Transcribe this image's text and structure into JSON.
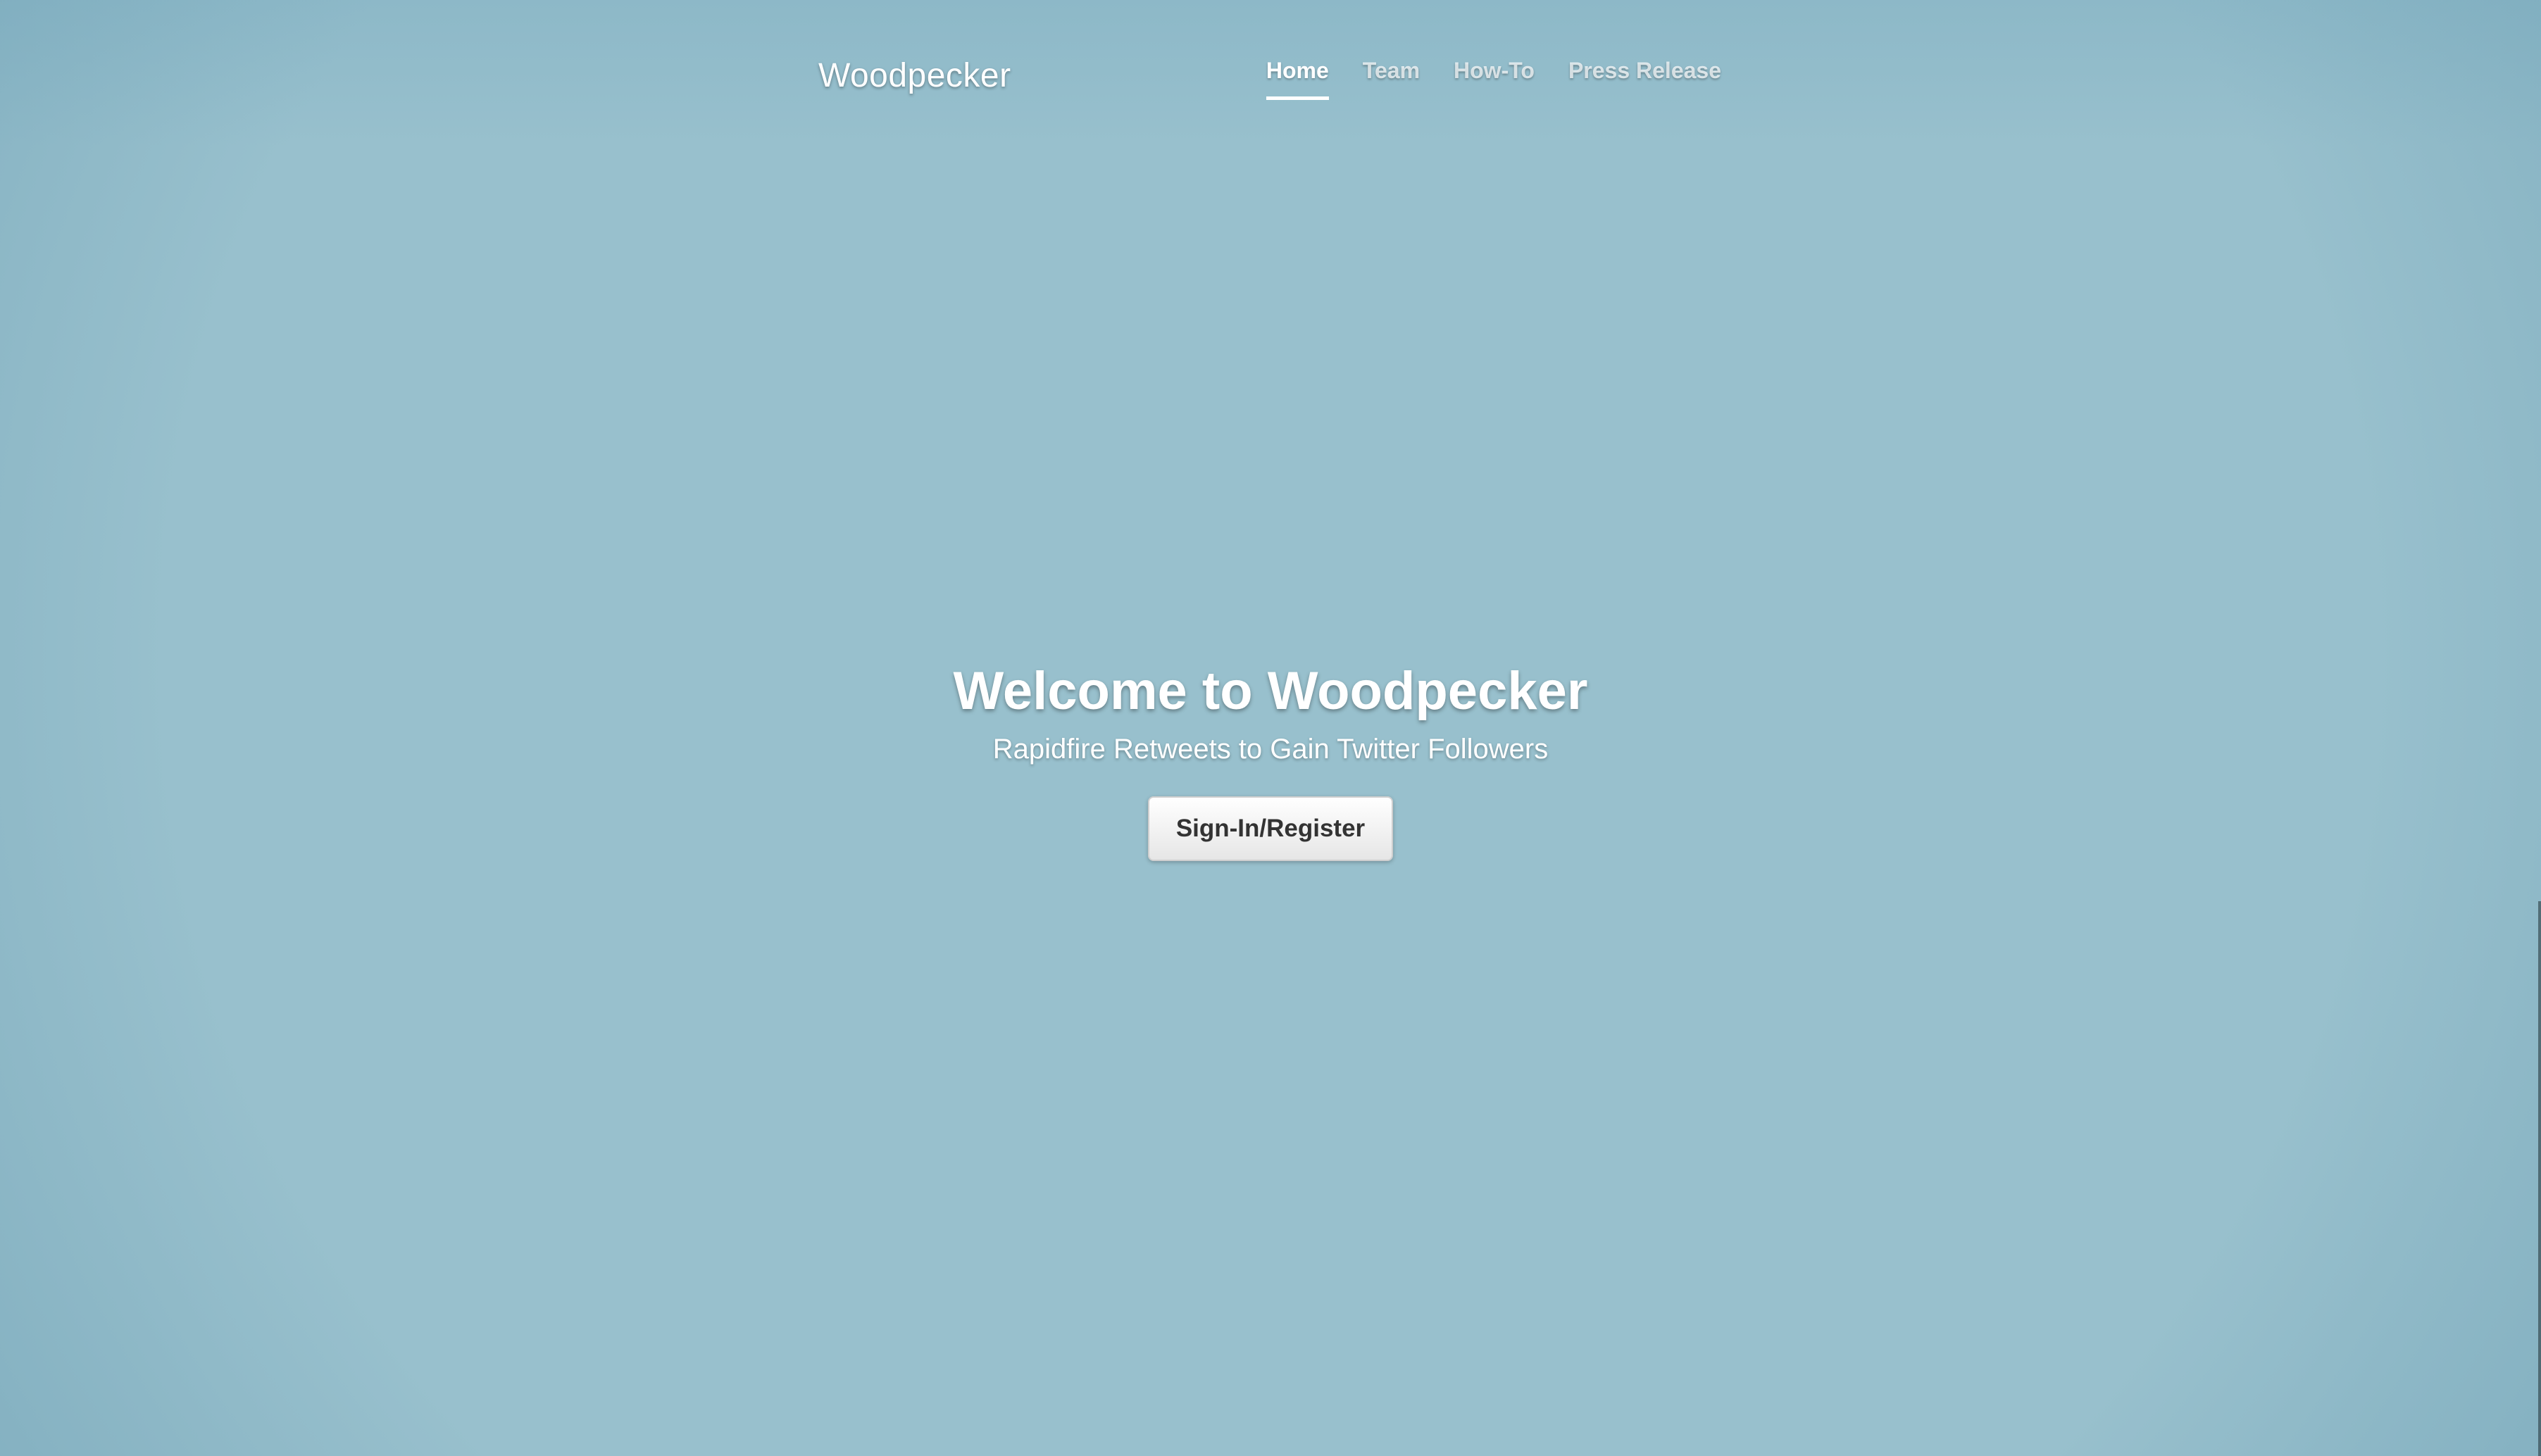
{
  "header": {
    "brand": "Woodpecker",
    "nav": [
      {
        "label": "Home",
        "active": true
      },
      {
        "label": "Team",
        "active": false
      },
      {
        "label": "How-To",
        "active": false
      },
      {
        "label": "Press Release",
        "active": false
      }
    ]
  },
  "hero": {
    "heading": "Welcome to Woodpecker",
    "subheading": "Rapidfire Retweets to Gain Twitter Followers",
    "cta_label": "Sign-In/Register"
  },
  "colors": {
    "background": "#98c0cd",
    "text": "#ffffff",
    "button_background": "#f2f2f2",
    "button_text": "#333333"
  }
}
